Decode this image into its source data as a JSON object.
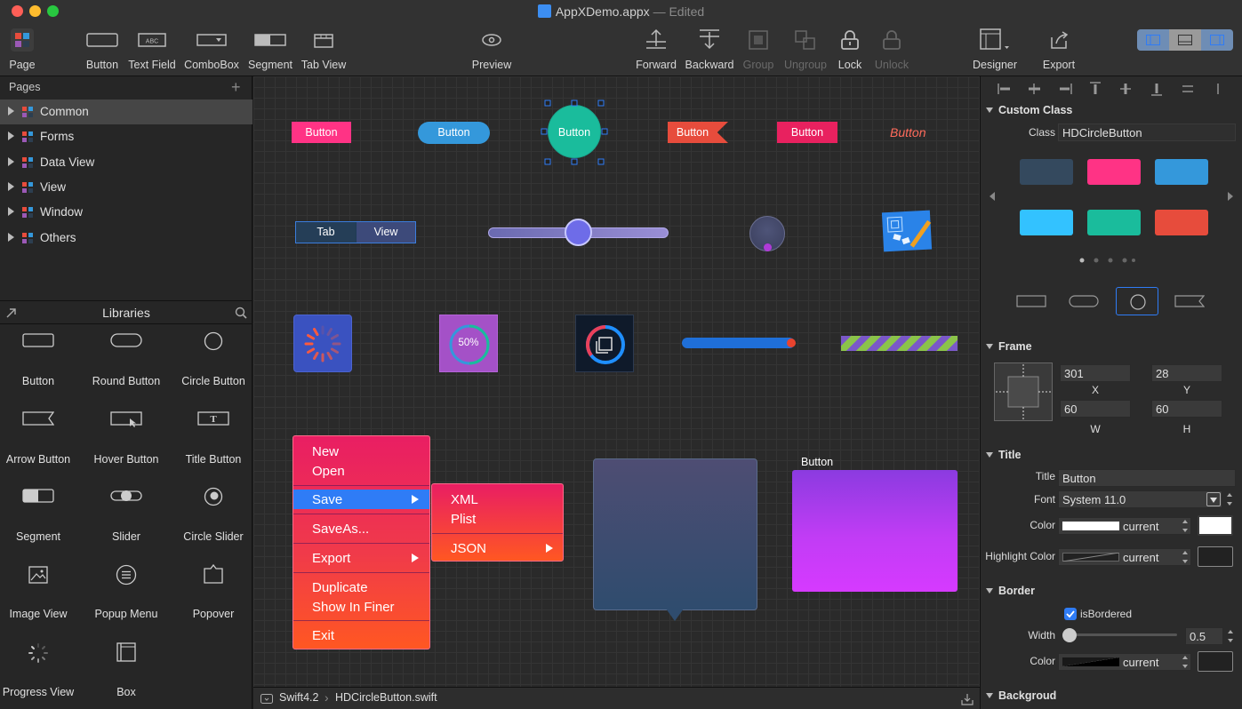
{
  "window": {
    "title": "AppXDemo.appx",
    "status": "— Edited"
  },
  "toolbar": {
    "page": "Page",
    "button": "Button",
    "text_field": "Text Field",
    "combobox": "ComboBox",
    "segment": "Segment",
    "tab_view": "Tab View",
    "preview": "Preview",
    "forward": "Forward",
    "backward": "Backward",
    "group": "Group",
    "ungroup": "Ungroup",
    "lock": "Lock",
    "unlock": "Unlock",
    "designer": "Designer",
    "export": "Export",
    "abc": "ABC"
  },
  "pages": {
    "title": "Pages",
    "items": [
      {
        "label": "Common",
        "selected": true
      },
      {
        "label": "Forms"
      },
      {
        "label": "Data View"
      },
      {
        "label": "View"
      },
      {
        "label": "Window"
      },
      {
        "label": "Others"
      }
    ]
  },
  "libraries": {
    "title": "Libraries",
    "items": [
      {
        "label": "Button"
      },
      {
        "label": "Round Button"
      },
      {
        "label": "Circle Button"
      },
      {
        "label": "Arrow Button"
      },
      {
        "label": "Hover Button"
      },
      {
        "label": "Title Button"
      },
      {
        "label": "Segment"
      },
      {
        "label": "Slider"
      },
      {
        "label": "Circle Slider"
      },
      {
        "label": "Image View"
      },
      {
        "label": "Popup Menu"
      },
      {
        "label": "Popover"
      },
      {
        "label": "Progress View"
      },
      {
        "label": "Box"
      }
    ],
    "title_button_glyph": "T"
  },
  "canvas": {
    "button_label": "Button",
    "tab_label": "Tab",
    "view_label": "View",
    "progress_text": "50%",
    "box_title": "Button",
    "slider_value": 0.5,
    "circle_progress": 0.5,
    "menu": {
      "new": "New",
      "open": "Open",
      "save": "Save",
      "save_as": "SaveAs...",
      "export": "Export",
      "duplicate": "Duplicate",
      "show_in_finer": "Show In Finer",
      "exit": "Exit"
    },
    "submenu": {
      "xml": "XML",
      "plist": "Plist",
      "json": "JSON"
    }
  },
  "statusbar": {
    "lang": "Swift4.2",
    "file": "HDCircleButton.swift"
  },
  "inspector": {
    "custom_class": {
      "section": "Custom Class",
      "class_label": "Class",
      "class_value": "HDCircleButton",
      "swatches": [
        "#34495e",
        "#ff3385",
        "#3498db",
        "#33c2ff",
        "#1abc9c",
        "#e74c3c"
      ]
    },
    "frame": {
      "section": "Frame",
      "x": "301",
      "y": "28",
      "w": "60",
      "h": "60",
      "x_label": "X",
      "y_label": "Y",
      "w_label": "W",
      "h_label": "H"
    },
    "title": {
      "section": "Title",
      "title_label": "Title",
      "title_value": "Button",
      "font_label": "Font",
      "font_value": "System  11.0",
      "color_label": "Color",
      "color_value": "current",
      "highlight_label": "Highlight Color",
      "highlight_value": "current"
    },
    "border": {
      "section": "Border",
      "bordered_label": "isBordered",
      "bordered": true,
      "width_label": "Width",
      "width_value": "0.5",
      "color_label": "Color",
      "color_value": "current"
    },
    "background": {
      "section": "Backgroud"
    }
  },
  "colors": {
    "accent": "#2f7cf6",
    "selection": "#464646",
    "menu_top": "#e91e63",
    "menu_bottom": "#ff5722"
  }
}
